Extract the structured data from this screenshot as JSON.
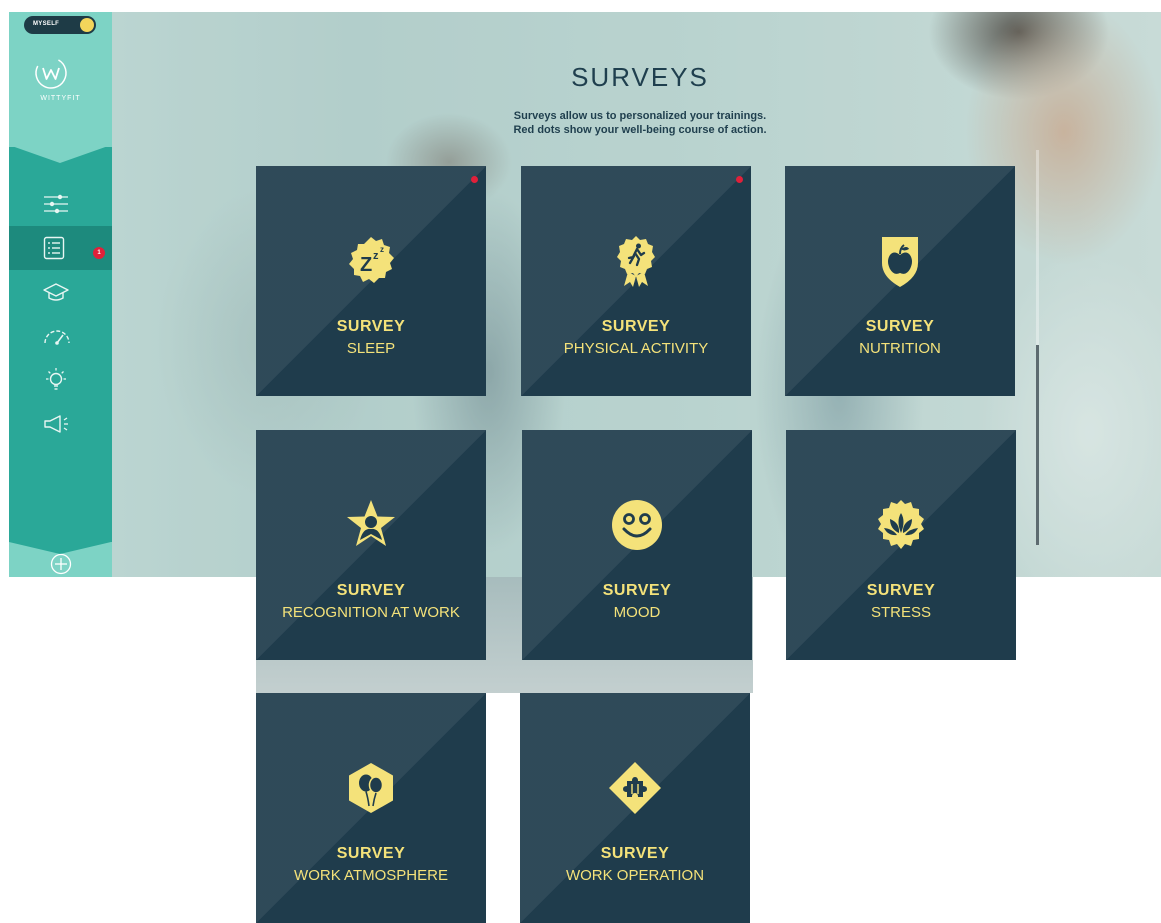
{
  "app": {
    "mode_toggle_label": "MYSELF",
    "logo_text": "WITTYFIT",
    "nav_badge_count": "1"
  },
  "page": {
    "title": "SURVEYS",
    "subtitle_line1": "Surveys allow us to personalized your trainings.",
    "subtitle_line2": "Red dots show your well-being course of action."
  },
  "colors": {
    "card_bg": "#1f3c4c",
    "accent_yellow": "#f4e27a",
    "sidebar_teal": "#2aa898",
    "badge_red": "#e0203a"
  },
  "surveys": [
    {
      "title": "SURVEY",
      "name": "SLEEP",
      "icon": "sleep-icon",
      "red_dot": true
    },
    {
      "title": "SURVEY",
      "name": "PHYSICAL ACTIVITY",
      "icon": "running-badge-icon",
      "red_dot": true
    },
    {
      "title": "SURVEY",
      "name": "NUTRITION",
      "icon": "apple-shield-icon",
      "red_dot": false
    },
    {
      "title": "SURVEY",
      "name": "RECOGNITION AT WORK",
      "icon": "star-person-icon",
      "red_dot": false
    },
    {
      "title": "SURVEY",
      "name": "MOOD",
      "icon": "smiley-icon",
      "red_dot": false
    },
    {
      "title": "SURVEY",
      "name": "STRESS",
      "icon": "lotus-icon",
      "red_dot": false
    },
    {
      "title": "SURVEY",
      "name": "WORK ATMOSPHERE",
      "icon": "balloon-hexagon-icon",
      "red_dot": false
    },
    {
      "title": "SURVEY",
      "name": "WORK OPERATION",
      "icon": "puzzle-diamond-icon",
      "red_dot": false
    }
  ]
}
